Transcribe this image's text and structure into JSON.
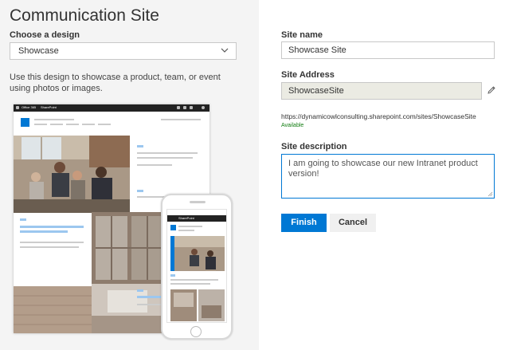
{
  "left": {
    "title": "Communication Site",
    "design_label": "Choose a design",
    "design_value": "Showcase",
    "description": "Use this design to showcase a product, team, or event using photos or images.",
    "preview_bar_left": "Office 365",
    "preview_bar_app": "SharePoint",
    "phone_app": "SharePoint"
  },
  "form": {
    "site_name_label": "Site name",
    "site_name_value": "Showcase Site",
    "site_address_label": "Site Address",
    "site_address_value": "ShowcaseSite",
    "site_url": "https://dynamicowlconsulting.sharepoint.com/sites/ShowcaseSite",
    "availability": "Available",
    "site_description_label": "Site description",
    "site_description_value": "I am going to showcase our new Intranet product version!",
    "finish_label": "Finish",
    "cancel_label": "Cancel"
  },
  "colors": {
    "accent": "#0078d4",
    "available": "#107c10",
    "left_bg": "#f4f4f4"
  }
}
